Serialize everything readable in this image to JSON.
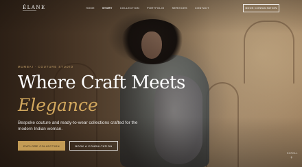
{
  "brand": {
    "logo": "ÉLANE"
  },
  "nav": {
    "items": [
      "HOME",
      "STORY",
      "COLLECTION",
      "PORTFOLIO",
      "SERVICES",
      "CONTACT"
    ],
    "cta": "BOOK CONSULTATION"
  },
  "hero": {
    "eyebrow": "MUMBAI · COUTURE STUDIO",
    "title_line1": "Where Craft Meets",
    "title_line2": "Elegance",
    "description": "Bespoke couture and ready-to-wear collections crafted for the modern Indian woman.",
    "primary_button": "EXPLORE COLLECTION",
    "secondary_button": "BOOK A CONSULTATION"
  },
  "scroll": {
    "label": "SCROLL",
    "icon": "plus-icon"
  },
  "colors": {
    "accent": "#c39b55",
    "accent_text": "#d2a85e",
    "eyebrow": "#c8a46b"
  }
}
